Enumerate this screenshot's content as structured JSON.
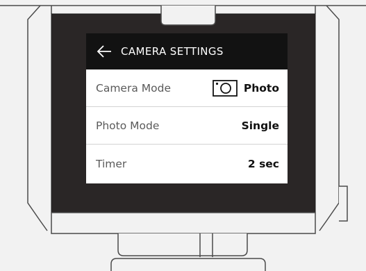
{
  "screen": {
    "title": "CAMERA SETTINGS",
    "back_icon": "arrow-left-icon"
  },
  "settings": [
    {
      "label": "Camera Mode",
      "value": "Photo",
      "icon": "camera-icon"
    },
    {
      "label": "Photo Mode",
      "value": "Single"
    },
    {
      "label": "Timer",
      "value": "2 sec"
    }
  ],
  "colors": {
    "device_body": "#f2f2f2",
    "bezel": "#2a2626",
    "header_bg": "#121212",
    "screen_bg": "#ffffff",
    "outline": "#4a4a4a"
  }
}
